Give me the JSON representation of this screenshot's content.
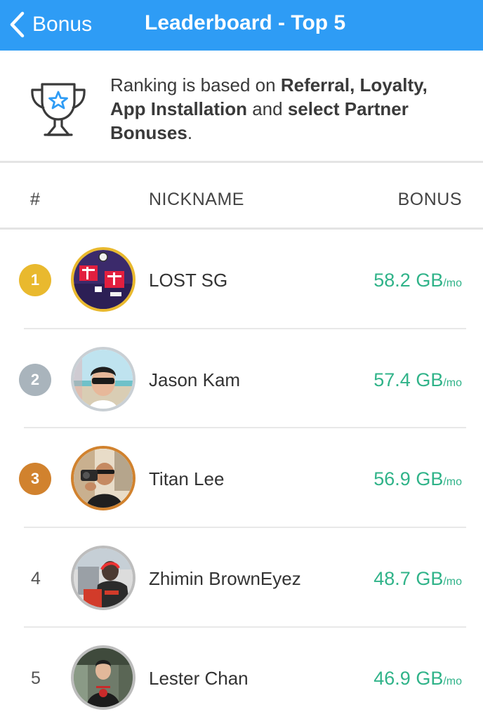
{
  "navbar": {
    "back_label": "Bonus",
    "title": "Leaderboard - Top 5",
    "background_color": "#2e9cf5"
  },
  "info": {
    "icon": "trophy-star-icon",
    "text_parts": [
      {
        "text": "Ranking is based on ",
        "bold": false
      },
      {
        "text": "Referral, Loyalty, App Installation",
        "bold": true
      },
      {
        "text": " and ",
        "bold": false
      },
      {
        "text": "select Partner Bonuses",
        "bold": true
      },
      {
        "text": ".",
        "bold": false
      }
    ]
  },
  "table": {
    "headers": {
      "rank": "#",
      "nickname": "NICKNAME",
      "bonus": "BONUS"
    },
    "rows": [
      {
        "rank": "1",
        "badge_color": "#e9b92e",
        "nickname": "LOST SG",
        "bonus_value": "58.2 GB",
        "bonus_unit": "/mo",
        "avatar": "lost-sg-avatar"
      },
      {
        "rank": "2",
        "badge_color": "#a9b4bc",
        "nickname": "Jason Kam",
        "bonus_value": "57.4 GB",
        "bonus_unit": "/mo",
        "avatar": "jason-kam-avatar"
      },
      {
        "rank": "3",
        "badge_color": "#d1822e",
        "nickname": "Titan Lee",
        "bonus_value": "56.9 GB",
        "bonus_unit": "/mo",
        "avatar": "titan-lee-avatar"
      },
      {
        "rank": "4",
        "badge_color": "",
        "nickname": "Zhimin BrownEyez",
        "bonus_value": "48.7 GB",
        "bonus_unit": "/mo",
        "avatar": "zhimin-browneyez-avatar"
      },
      {
        "rank": "5",
        "badge_color": "",
        "nickname": "Lester Chan",
        "bonus_value": "46.9 GB",
        "bonus_unit": "/mo",
        "avatar": "lester-chan-avatar"
      }
    ]
  },
  "colors": {
    "accent": "#2e9cf5",
    "bonus_green": "#30b389",
    "gold": "#e9b92e",
    "silver": "#a9b4bc",
    "bronze": "#d1822e"
  }
}
